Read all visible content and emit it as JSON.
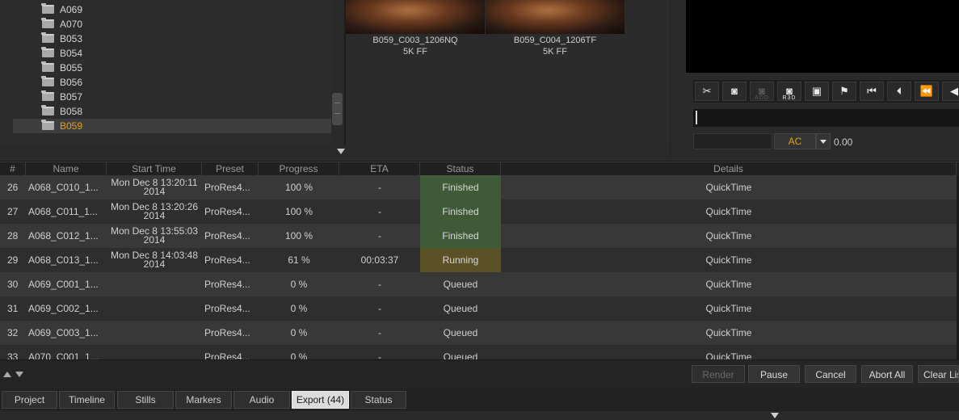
{
  "tree": {
    "folders": [
      {
        "label": "A069",
        "selected": false
      },
      {
        "label": "A070",
        "selected": false
      },
      {
        "label": "B053",
        "selected": false
      },
      {
        "label": "B054",
        "selected": false
      },
      {
        "label": "B055",
        "selected": false
      },
      {
        "label": "B056",
        "selected": false
      },
      {
        "label": "B057",
        "selected": false
      },
      {
        "label": "B058",
        "selected": false
      },
      {
        "label": "B059",
        "selected": true
      }
    ]
  },
  "thumbnails": [
    {
      "name": "B059_C003_1206NQ",
      "format": "5K FF"
    },
    {
      "name": "B059_C004_1206TF",
      "format": "5K FF"
    }
  ],
  "viewer": {
    "toolbar": [
      {
        "icon": "trim-icon",
        "glyph": "✂",
        "sub": "",
        "enabled": true
      },
      {
        "icon": "camera-icon",
        "glyph": "◙",
        "sub": "",
        "enabled": true
      },
      {
        "icon": "camera-add-icon",
        "glyph": "◙",
        "sub": "ADD",
        "enabled": false
      },
      {
        "icon": "camera-r3d-icon",
        "glyph": "◙",
        "sub": "R3D",
        "enabled": true
      },
      {
        "icon": "export-frame-icon",
        "glyph": "▣",
        "sub": "",
        "enabled": true
      },
      {
        "icon": "flag-icon",
        "glyph": "⚑",
        "sub": "",
        "enabled": true
      },
      {
        "icon": "skip-start-icon",
        "glyph": "⏮",
        "sub": "",
        "enabled": true
      },
      {
        "icon": "step-back-icon",
        "glyph": "⏴",
        "sub": "",
        "enabled": true
      },
      {
        "icon": "rewind-icon",
        "glyph": "⏪",
        "sub": "",
        "enabled": true
      },
      {
        "icon": "play-reverse-icon",
        "glyph": "◀",
        "sub": "",
        "enabled": true
      }
    ],
    "ac_label": "AC",
    "ac_value": "0.00"
  },
  "table": {
    "columns": [
      "#",
      "Name",
      "Start Time",
      "Preset",
      "Progress",
      "ETA",
      "Status",
      "Details"
    ],
    "rows": [
      {
        "num": "26",
        "name": "A068_C010_1...",
        "start_line1": "Mon Dec 8 13:20:11",
        "start_line2": "2014",
        "preset": "ProRes4...",
        "progress": "100 %",
        "eta": "-",
        "status": "Finished",
        "details": "QuickTime"
      },
      {
        "num": "27",
        "name": "A068_C011_1...",
        "start_line1": "Mon Dec 8 13:20:26",
        "start_line2": "2014",
        "preset": "ProRes4...",
        "progress": "100 %",
        "eta": "-",
        "status": "Finished",
        "details": "QuickTime"
      },
      {
        "num": "28",
        "name": "A068_C012_1...",
        "start_line1": "Mon Dec 8 13:55:03",
        "start_line2": "2014",
        "preset": "ProRes4...",
        "progress": "100 %",
        "eta": "-",
        "status": "Finished",
        "details": "QuickTime"
      },
      {
        "num": "29",
        "name": "A068_C013_1...",
        "start_line1": "Mon Dec 8 14:03:48",
        "start_line2": "2014",
        "preset": "ProRes4...",
        "progress": "61 %",
        "eta": "00:03:37",
        "status": "Running",
        "details": "QuickTime"
      },
      {
        "num": "30",
        "name": "A069_C001_1...",
        "start_line1": "",
        "start_line2": "",
        "preset": "ProRes4...",
        "progress": "0 %",
        "eta": "-",
        "status": "Queued",
        "details": "QuickTime"
      },
      {
        "num": "31",
        "name": "A069_C002_1...",
        "start_line1": "",
        "start_line2": "",
        "preset": "ProRes4...",
        "progress": "0 %",
        "eta": "-",
        "status": "Queued",
        "details": "QuickTime"
      },
      {
        "num": "32",
        "name": "A069_C003_1...",
        "start_line1": "",
        "start_line2": "",
        "preset": "ProRes4...",
        "progress": "0 %",
        "eta": "-",
        "status": "Queued",
        "details": "QuickTime"
      },
      {
        "num": "33",
        "name": "A070_C001_1...",
        "start_line1": "",
        "start_line2": "",
        "preset": "ProRes4...",
        "progress": "0 %",
        "eta": "-",
        "status": "Queued",
        "details": "QuickTime"
      }
    ],
    "status_colors": {
      "Finished": "#3e5a36",
      "Running": "#5a5226"
    }
  },
  "controls": {
    "render": "Render",
    "pause": "Pause",
    "cancel": "Cancel",
    "abort_all": "Abort All",
    "clear_list": "Clear List"
  },
  "tabs": [
    {
      "label": "Project",
      "active": false
    },
    {
      "label": "Timeline",
      "active": false
    },
    {
      "label": "Stills",
      "active": false
    },
    {
      "label": "Markers",
      "active": false
    },
    {
      "label": "Audio",
      "active": false
    },
    {
      "label": "Export (44)",
      "active": true
    },
    {
      "label": "Status",
      "active": false
    }
  ]
}
